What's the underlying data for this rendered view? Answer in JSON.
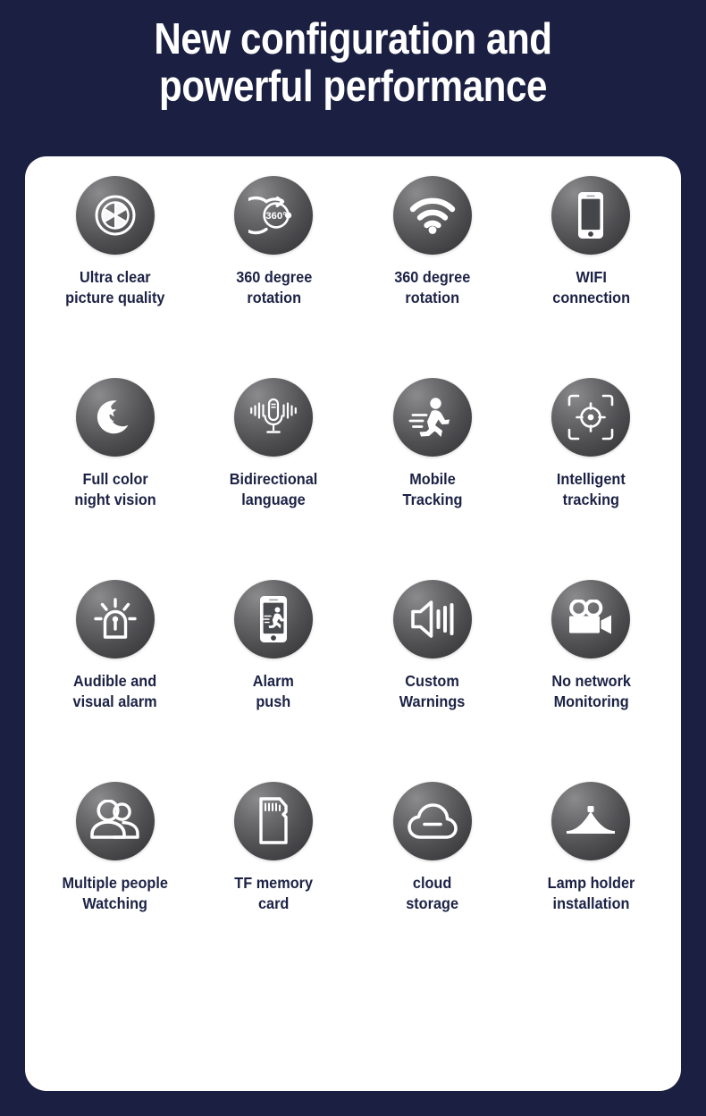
{
  "header": {
    "title_line1": "New configuration and",
    "title_line2": "powerful performance"
  },
  "colors": {
    "background": "#1b2043",
    "card": "#ffffff",
    "label_text": "#1c2245",
    "title_text": "#ffffff",
    "icon_gradient_light": "#8b8b8d",
    "icon_gradient_dark": "#3a3a3d",
    "icon_glyph": "#ffffff"
  },
  "features": [
    {
      "icon": "camera-aperture-icon",
      "label": "Ultra clear\npicture quality"
    },
    {
      "icon": "360-rotation-icon",
      "label": "360 degree\nrotation"
    },
    {
      "icon": "wifi-signal-icon",
      "label": "360 degree\nrotation"
    },
    {
      "icon": "smartphone-icon",
      "label": "WIFI\nconnection"
    },
    {
      "icon": "moon-stars-icon",
      "label": "Full color\nnight vision"
    },
    {
      "icon": "microphone-waves-icon",
      "label": "Bidirectional\nlanguage"
    },
    {
      "icon": "running-person-icon",
      "label": "Mobile\nTracking"
    },
    {
      "icon": "crosshair-target-icon",
      "label": "Intelligent\ntracking"
    },
    {
      "icon": "alarm-siren-icon",
      "label": "Audible and\nvisual alarm"
    },
    {
      "icon": "phone-alert-icon",
      "label": "Alarm\npush"
    },
    {
      "icon": "speaker-volume-icon",
      "label": "Custom\nWarnings"
    },
    {
      "icon": "video-camera-icon",
      "label": "No network\nMonitoring"
    },
    {
      "icon": "people-group-icon",
      "label": "Multiple people\nWatching"
    },
    {
      "icon": "sd-card-icon",
      "label": "TF memory\ncard"
    },
    {
      "icon": "cloud-storage-icon",
      "label": "cloud\nstorage"
    },
    {
      "icon": "lamp-holder-icon",
      "label": "Lamp holder\ninstallation"
    }
  ],
  "icon_text": {
    "degrees_360": "360°"
  }
}
